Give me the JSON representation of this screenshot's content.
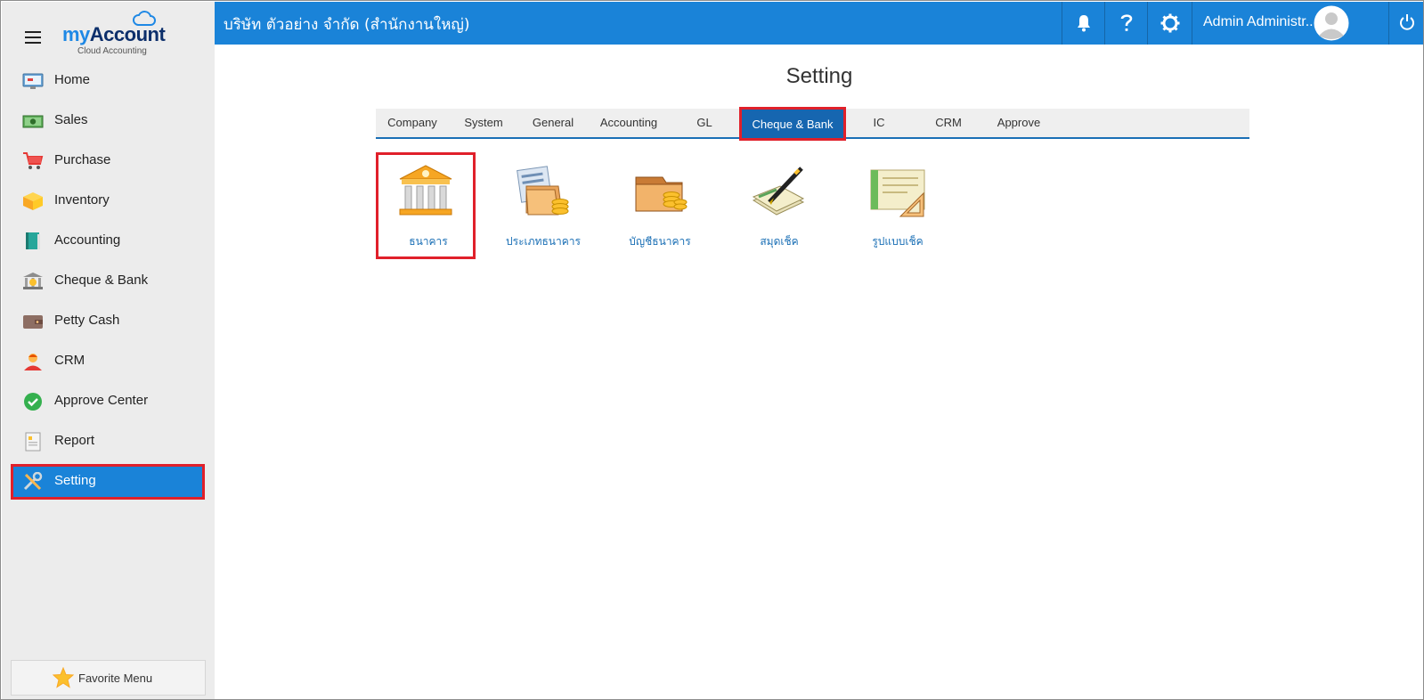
{
  "app": {
    "logo_my": "my",
    "logo_account": "Account",
    "logo_subtitle": "Cloud Accounting"
  },
  "topbar": {
    "company": "บริษัท ตัวอย่าง จำกัด (สำนักงานใหญ่)",
    "user_name": "Admin Administr...",
    "icons": [
      "bell-icon",
      "help-icon",
      "gear-icon",
      "avatar",
      "power-icon"
    ]
  },
  "sidebar": {
    "items": [
      {
        "label": "Home",
        "icon": "home-icon"
      },
      {
        "label": "Sales",
        "icon": "cash-icon"
      },
      {
        "label": "Purchase",
        "icon": "cart-icon"
      },
      {
        "label": "Inventory",
        "icon": "box-icon"
      },
      {
        "label": "Accounting",
        "icon": "book-icon"
      },
      {
        "label": "Cheque & Bank",
        "icon": "bank-icon"
      },
      {
        "label": "Petty Cash",
        "icon": "wallet-icon"
      },
      {
        "label": "CRM",
        "icon": "person-icon"
      },
      {
        "label": "Approve Center",
        "icon": "check-circle-icon"
      },
      {
        "label": "Report",
        "icon": "report-icon"
      },
      {
        "label": "Setting",
        "icon": "tools-icon",
        "active": true
      }
    ],
    "favorite_label": "Favorite Menu"
  },
  "main": {
    "title": "Setting",
    "tabs": [
      {
        "label": "Company"
      },
      {
        "label": "System"
      },
      {
        "label": "General"
      },
      {
        "label": "Accounting"
      },
      {
        "label": "GL"
      },
      {
        "label": "Cheque & Bank",
        "active": true
      },
      {
        "label": "IC"
      },
      {
        "label": "CRM"
      },
      {
        "label": "Approve"
      }
    ],
    "tiles": [
      {
        "label": "ธนาคาร",
        "icon": "bank-building-icon",
        "selected": true
      },
      {
        "label": "ประเภทธนาคาร",
        "icon": "bank-type-icon"
      },
      {
        "label": "บัญชีธนาคาร",
        "icon": "bank-account-icon"
      },
      {
        "label": "สมุดเช็ค",
        "icon": "cheque-book-icon"
      },
      {
        "label": "รูปแบบเช็ค",
        "icon": "cheque-format-icon"
      }
    ]
  },
  "colors": {
    "primary": "#1a83d8",
    "highlight_border": "#e0202a",
    "sidebar_bg": "#ececec",
    "tab_active": "#1666b0",
    "tile_label": "#1a6fb5"
  }
}
